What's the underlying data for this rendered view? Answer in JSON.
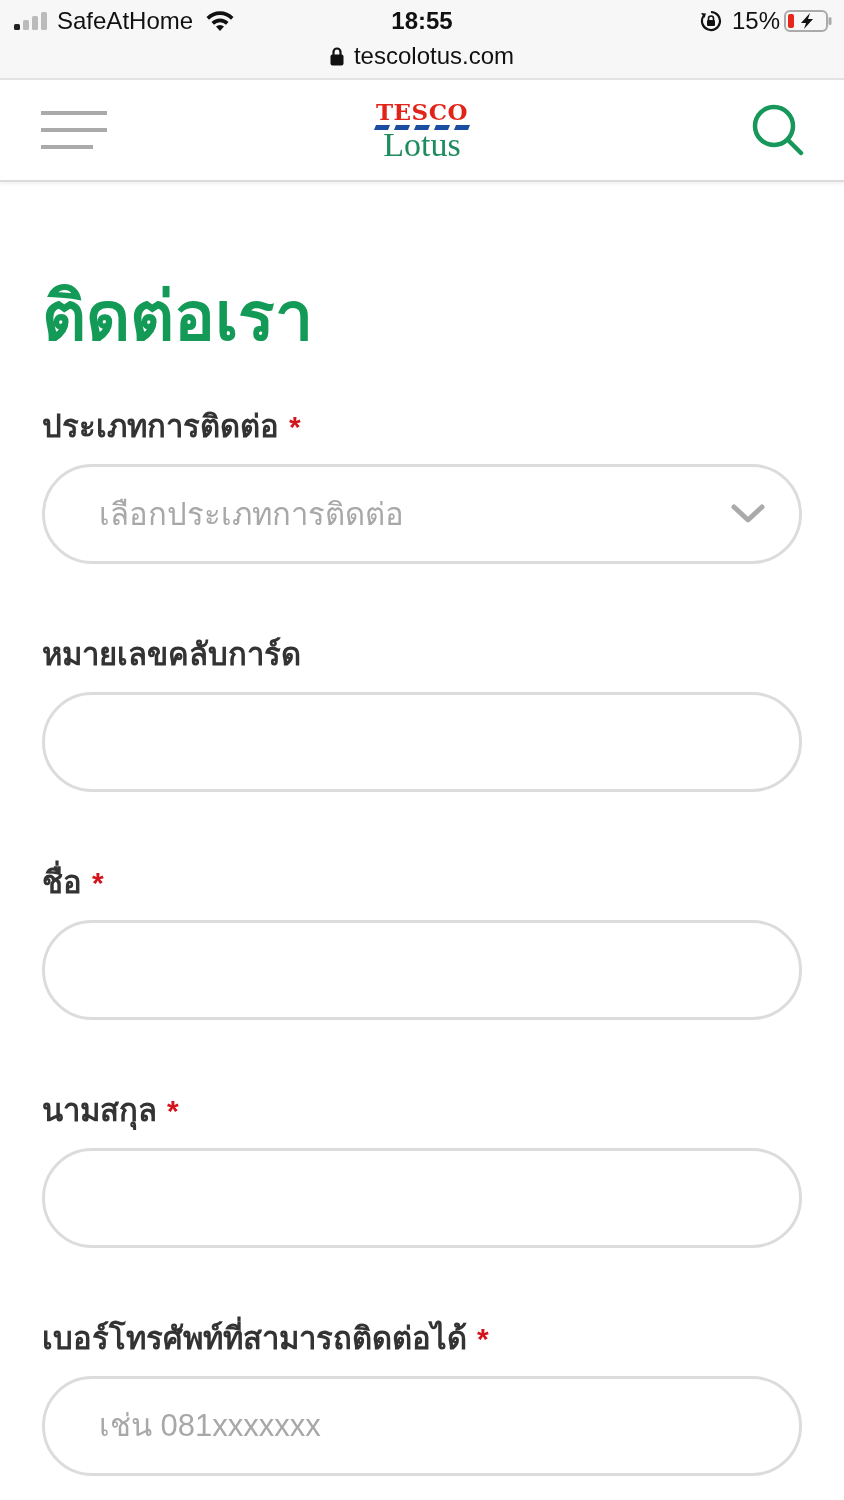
{
  "status_bar": {
    "carrier": "SafeAtHome",
    "time": "18:55",
    "battery": "15%",
    "url": "tescolotus.com"
  },
  "header": {
    "logo": {
      "top": "TESCO",
      "bottom": "Lotus"
    }
  },
  "page": {
    "title": "ติดต่อเรา"
  },
  "form": {
    "fields": [
      {
        "kind": "select",
        "label": "ประเภทการติดต่อ",
        "required_mark": "*",
        "placeholder": "เลือกประเภทการติดต่อ"
      },
      {
        "kind": "text",
        "label": "หมายเลขคลับการ์ด"
      },
      {
        "kind": "text",
        "label": "ชื่อ",
        "required_mark": "*"
      },
      {
        "kind": "text",
        "label": "นามสกุล",
        "required_mark": "*"
      },
      {
        "kind": "text",
        "label": "เบอร์โทรศัพท์ที่สามารถติดต่อได้",
        "required_mark": "*",
        "placeholder": "เช่น 081xxxxxxx"
      }
    ]
  }
}
